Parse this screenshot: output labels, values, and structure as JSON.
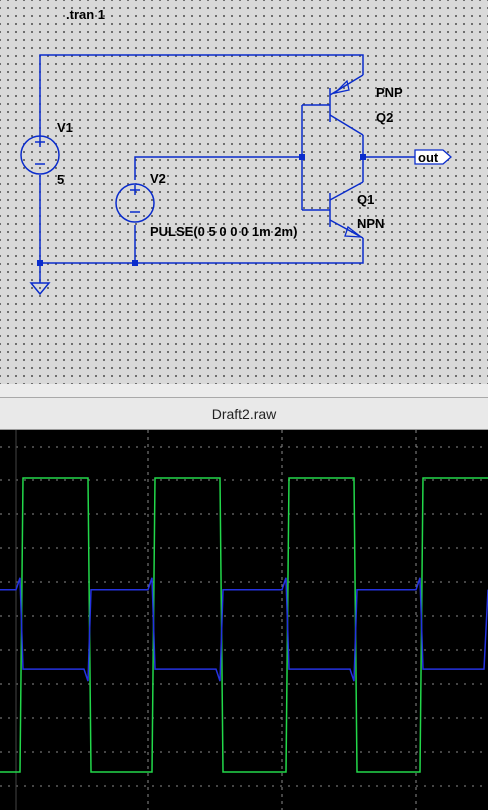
{
  "schematic": {
    "directive": ".tran 1",
    "v1": {
      "name": "V1",
      "value": "5"
    },
    "v2": {
      "name": "V2",
      "value": "PULSE(0 5 0 0 0 1m 2m)"
    },
    "q1": {
      "name": "Q1",
      "model": "NPN"
    },
    "q2": {
      "name": "Q2",
      "model": "PNP"
    },
    "out_label": "out"
  },
  "waveform_window": {
    "title": "Draft2.raw"
  },
  "colors": {
    "wire": "#0a2ccc",
    "trace_input": "#22d84a",
    "trace_output": "#2432e0",
    "grid": "#8a8a8a"
  },
  "chart_data": {
    "type": "line",
    "period_ms": 2,
    "duty": 0.5,
    "series": [
      {
        "kind": "square",
        "high": 1,
        "low": 0
      },
      {
        "kind": "square-inverted",
        "high": 0.62,
        "low": 0.35
      }
    ]
  }
}
